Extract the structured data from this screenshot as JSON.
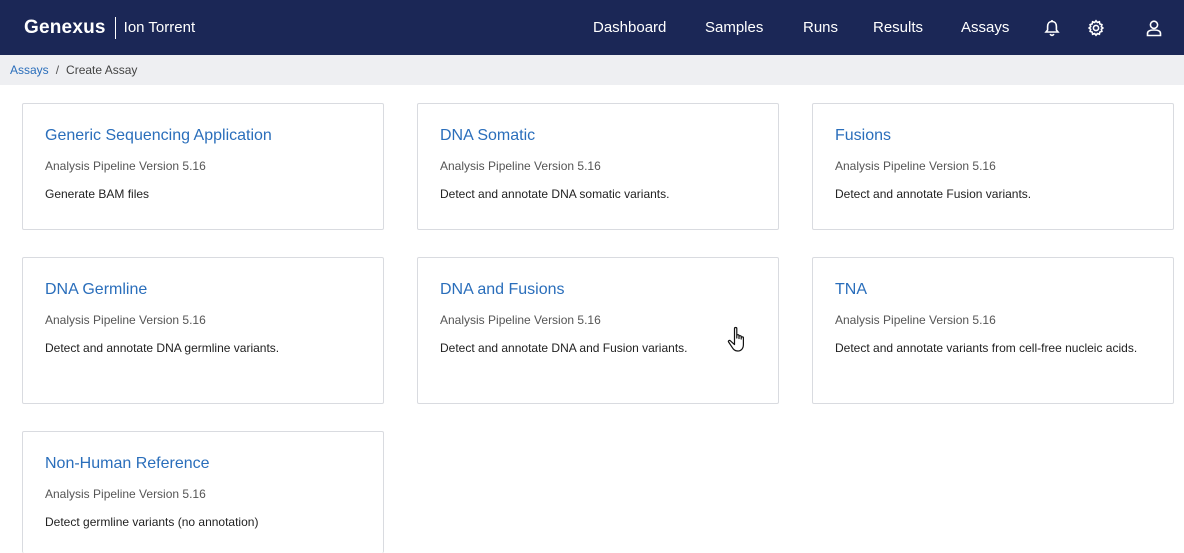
{
  "header": {
    "brand": "Genexus",
    "sub_brand": "Ion Torrent",
    "nav": [
      {
        "label": "Dashboard"
      },
      {
        "label": "Samples"
      },
      {
        "label": "Runs"
      },
      {
        "label": "Results"
      },
      {
        "label": "Assays"
      }
    ],
    "icons": [
      "bell-icon",
      "gear-icon",
      "user-icon"
    ]
  },
  "breadcrumb": {
    "link": "Assays",
    "separator": "/",
    "current": "Create Assay"
  },
  "cards": [
    {
      "title": "Generic Sequencing Application",
      "version": "Analysis Pipeline Version 5.16",
      "description": "Generate BAM files"
    },
    {
      "title": "DNA Somatic",
      "version": "Analysis Pipeline Version 5.16",
      "description": "Detect and annotate DNA somatic variants."
    },
    {
      "title": "Fusions",
      "version": "Analysis Pipeline Version 5.16",
      "description": "Detect and annotate Fusion variants."
    },
    {
      "title": "DNA Germline",
      "version": "Analysis Pipeline Version 5.16",
      "description": "Detect and annotate DNA germline variants."
    },
    {
      "title": "DNA and Fusions",
      "version": "Analysis Pipeline Version 5.16",
      "description": "Detect and annotate DNA and Fusion variants."
    },
    {
      "title": "TNA",
      "version": "Analysis Pipeline Version 5.16",
      "description": "Detect and annotate variants from cell-free nucleic acids."
    },
    {
      "title": "Non-Human Reference",
      "version": "Analysis Pipeline Version 5.16",
      "description": "Detect germline variants (no annotation)"
    }
  ],
  "colors": {
    "header_bg": "#1b2756",
    "link": "#2a6ebb",
    "breadcrumb_bg": "#eeeff2",
    "card_border": "#d9dbe0"
  }
}
